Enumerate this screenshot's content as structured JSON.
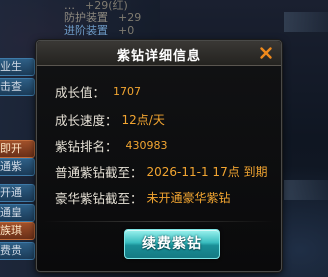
{
  "background": {
    "top_rows": [
      {
        "label": "…",
        "value": "+29(红)"
      },
      {
        "label": "防护装置",
        "value": "+29"
      },
      {
        "label": "进阶装置",
        "value": "+0"
      }
    ],
    "left_buttons": [
      "业生",
      "击查",
      "即开",
      "通紫",
      "开通",
      "通皇",
      "族琪",
      "费贵"
    ]
  },
  "dialog": {
    "title": "紫钻详细信息",
    "rows": [
      {
        "label": "成长值：",
        "value": "1707"
      },
      {
        "label": "成长速度：",
        "value": "12点/天"
      },
      {
        "label": "紫钻排名：",
        "value": "430983"
      },
      {
        "label": "普通紫钻截至：",
        "value": "2026-11-1 17点 到期"
      },
      {
        "label": "豪华紫钻截至：",
        "value": "未开通豪华紫钻"
      }
    ],
    "renew_button": "续费紫钻"
  },
  "colors": {
    "accent_orange": "#f2a531",
    "close_x": "#f08a1c",
    "button_teal": "#39bdbf",
    "label_text": "#e6e1d6"
  },
  "icons": {
    "close": "close-icon"
  }
}
